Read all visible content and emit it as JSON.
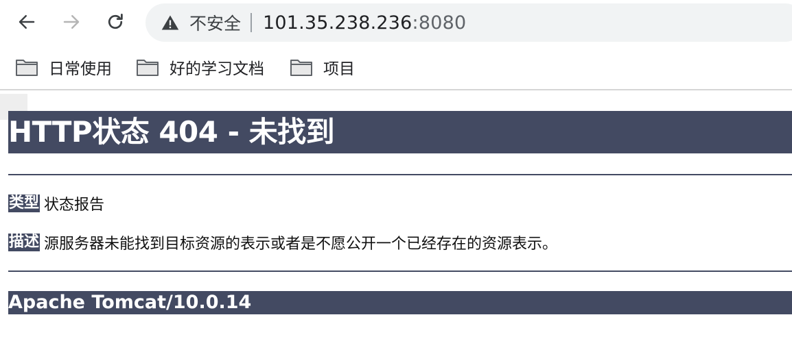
{
  "browser": {
    "security_label": "不安全",
    "url_host": "101.35.238.236",
    "url_port": ":8080",
    "bookmarks": [
      {
        "label": "日常使用"
      },
      {
        "label": "好的学习文档"
      },
      {
        "label": "项目"
      }
    ]
  },
  "page": {
    "heading": "HTTP状态 404 - 未找到",
    "type_label": "类型",
    "type_value": "状态报告",
    "desc_label": "描述",
    "desc_value": "源服务器未能找到目标资源的表示或者是不愿公开一个已经存在的资源表示。",
    "server_footer": "Apache Tomcat/10.0.14"
  }
}
